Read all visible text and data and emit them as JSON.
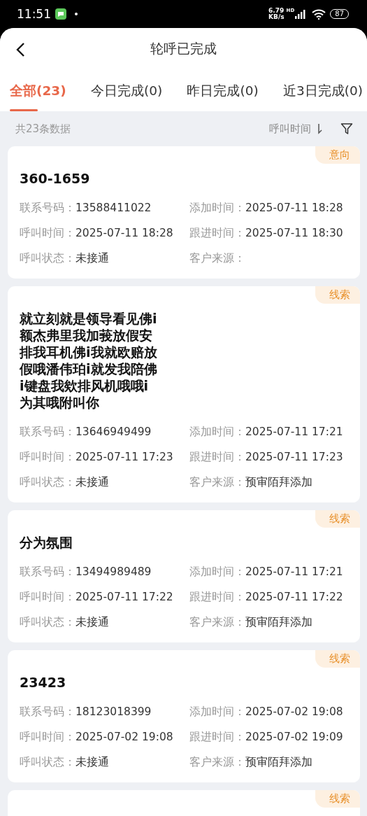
{
  "status_bar": {
    "time": "11:51",
    "speed_value": "6.79",
    "speed_unit": "KB/s",
    "network": "HD",
    "battery": "87"
  },
  "header": {
    "title": "轮呼已完成"
  },
  "tabs": [
    {
      "label": "全部(23)",
      "selected": true
    },
    {
      "label": "今日完成(0)",
      "selected": false
    },
    {
      "label": "昨日完成(0)",
      "selected": false
    },
    {
      "label": "近3日完成(0)",
      "selected": false
    }
  ],
  "summary": {
    "count": "共23条数据",
    "sort_label": "呼叫时间"
  },
  "cards": [
    {
      "tag": "意向",
      "title": "360-1659",
      "fields": [
        {
          "label": "联系号码：",
          "value": "13588411022"
        },
        {
          "label": "添加时间：",
          "value": "2025-07-11 18:28"
        },
        {
          "label": "呼叫时间：",
          "value": "2025-07-11 18:28"
        },
        {
          "label": "跟进时间：",
          "value": "2025-07-11 18:30"
        },
        {
          "label": "呼叫状态：",
          "value": "未接通"
        },
        {
          "label": "客户来源："
        }
      ]
    },
    {
      "tag": "线索",
      "title": "就立刻就是领导看见佛i额杰弗里我加莪放假安排我耳机佛i我就欧赔放假哦潘伟珀i就发我陪佛i键盘我欸排风机哦哦i为其哦附叫你",
      "fields": [
        {
          "label": "联系号码：",
          "value": "13646949499"
        },
        {
          "label": "添加时间：",
          "value": "2025-07-11 17:21"
        },
        {
          "label": "呼叫时间：",
          "value": "2025-07-11 17:23"
        },
        {
          "label": "跟进时间：",
          "value": "2025-07-11 17:23"
        },
        {
          "label": "呼叫状态：",
          "value": "未接通"
        },
        {
          "label": "客户来源：",
          "value": "预审陌拜添加"
        }
      ]
    },
    {
      "tag": "线索",
      "title": "分为氛围",
      "fields": [
        {
          "label": "联系号码：",
          "value": "13494989489"
        },
        {
          "label": "添加时间：",
          "value": "2025-07-11 17:21"
        },
        {
          "label": "呼叫时间：",
          "value": "2025-07-11 17:22"
        },
        {
          "label": "跟进时间：",
          "value": "2025-07-11 17:22"
        },
        {
          "label": "呼叫状态：",
          "value": "未接通"
        },
        {
          "label": "客户来源：",
          "value": "预审陌拜添加"
        }
      ]
    },
    {
      "tag": "线索",
      "title": "23423",
      "fields": [
        {
          "label": "联系号码：",
          "value": "18123018399"
        },
        {
          "label": "添加时间：",
          "value": "2025-07-02 19:08"
        },
        {
          "label": "呼叫时间：",
          "value": "2025-07-02 19:08"
        },
        {
          "label": "跟进时间：",
          "value": "2025-07-02 19:09"
        },
        {
          "label": "呼叫状态：",
          "value": "未接通"
        },
        {
          "label": "客户来源：",
          "value": "预审陌拜添加"
        }
      ]
    },
    {
      "tag": "线索"
    }
  ]
}
